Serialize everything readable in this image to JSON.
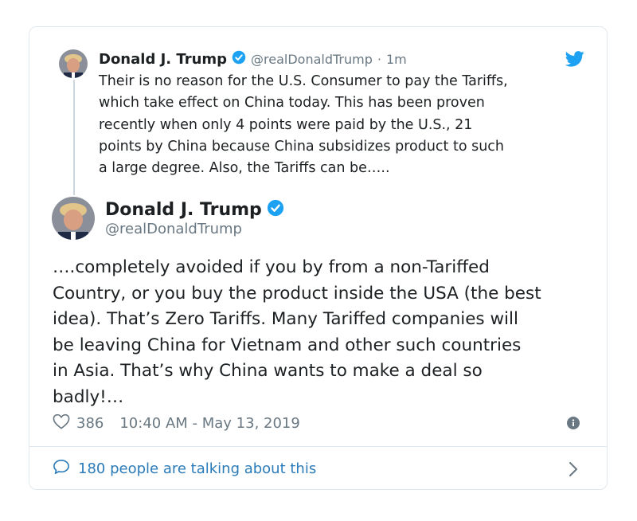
{
  "quoted_tweet": {
    "author_name": "Donald J. Trump",
    "handle": "@realDonaldTrump",
    "separator": "·",
    "relative_time": "1m",
    "text": "Their is no reason for the U.S. Consumer to pay the Tariffs,\nwhich take effect on China today. This has been proven\nrecently when only 4 points were paid by the U.S., 21\npoints by China because China subsidizes product to such\na large degree. Also, the Tariffs can be….."
  },
  "main_tweet": {
    "author_name": "Donald J. Trump",
    "handle": "@realDonaldTrump",
    "text": "….completely avoided if you by from a non-Tariffed\nCountry, or you buy the product inside the USA (the best\nidea). That’s Zero Tariffs. Many Tariffed companies will\nbe leaving China for Vietnam and other such countries\nin Asia. That’s why China wants to make a deal so\nbadly!…",
    "like_count": "386",
    "timestamp": "10:40 AM - May 13, 2019"
  },
  "footer": {
    "talking_text": "180 people are talking about this"
  },
  "icons": {
    "verified": "verified-badge-icon",
    "bird": "twitter-bird-icon",
    "heart": "heart-icon",
    "info": "info-icon",
    "comment": "comment-bubble-icon",
    "chevron": "chevron-right-icon"
  },
  "colors": {
    "verified_blue": "#1da1f2",
    "link_blue": "#2b7bb9",
    "muted_gray": "#697882",
    "border": "#e1e8ed",
    "text": "#1c2022"
  }
}
